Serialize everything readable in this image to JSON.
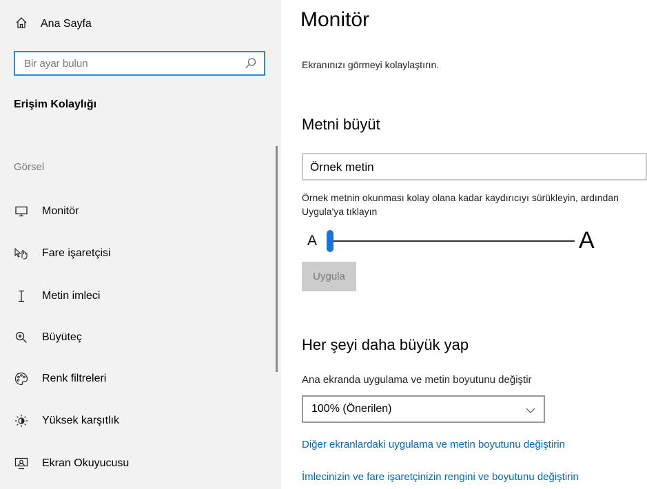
{
  "sidebar": {
    "home_label": "Ana Sayfa",
    "search_placeholder": "Bir ayar bulun",
    "heading": "Erişim Kolaylığı",
    "group_label": "Görsel",
    "items": [
      {
        "label": "Monitör",
        "icon": "monitor-icon"
      },
      {
        "label": "Fare işaretçisi",
        "icon": "mouse-pointer-icon"
      },
      {
        "label": "Metin imleci",
        "icon": "text-cursor-icon"
      },
      {
        "label": "Büyüteç",
        "icon": "magnifier-icon"
      },
      {
        "label": "Renk filtreleri",
        "icon": "color-filter-icon"
      },
      {
        "label": "Yüksek karşıtlık",
        "icon": "high-contrast-icon"
      },
      {
        "label": "Ekran Okuyucusu",
        "icon": "narrator-icon"
      }
    ]
  },
  "main": {
    "title": "Monitör",
    "description": "Ekranınızı görmeyi kolaylaştırın.",
    "text_section": {
      "title": "Metni büyüt",
      "sample_text": "Örnek metin",
      "instruction": "Örnek metnin okunması kolay olana kadar kaydırıcıyı sürükleyin, ardından Uygula'ya tıklayın",
      "slider_small_label": "A",
      "slider_large_label": "A",
      "slider_value": 0,
      "apply_label": "Uygula"
    },
    "scale_section": {
      "title": "Her şeyi daha büyük yap",
      "label": "Ana ekranda uygulama ve metin boyutunu değiştir",
      "selected_option": "100% (Önerilen)",
      "link_other_displays": "Diğer ekranlardaki uygulama ve metin boyutunu değiştirin",
      "link_pointer": "İmlecinizin ve fare işaretçinizin rengini ve boyutunu değiştirin"
    }
  },
  "colors": {
    "accent": "#0067c0",
    "sidebar_bg": "#f2f2f2",
    "search_border": "#2b8ad6"
  }
}
